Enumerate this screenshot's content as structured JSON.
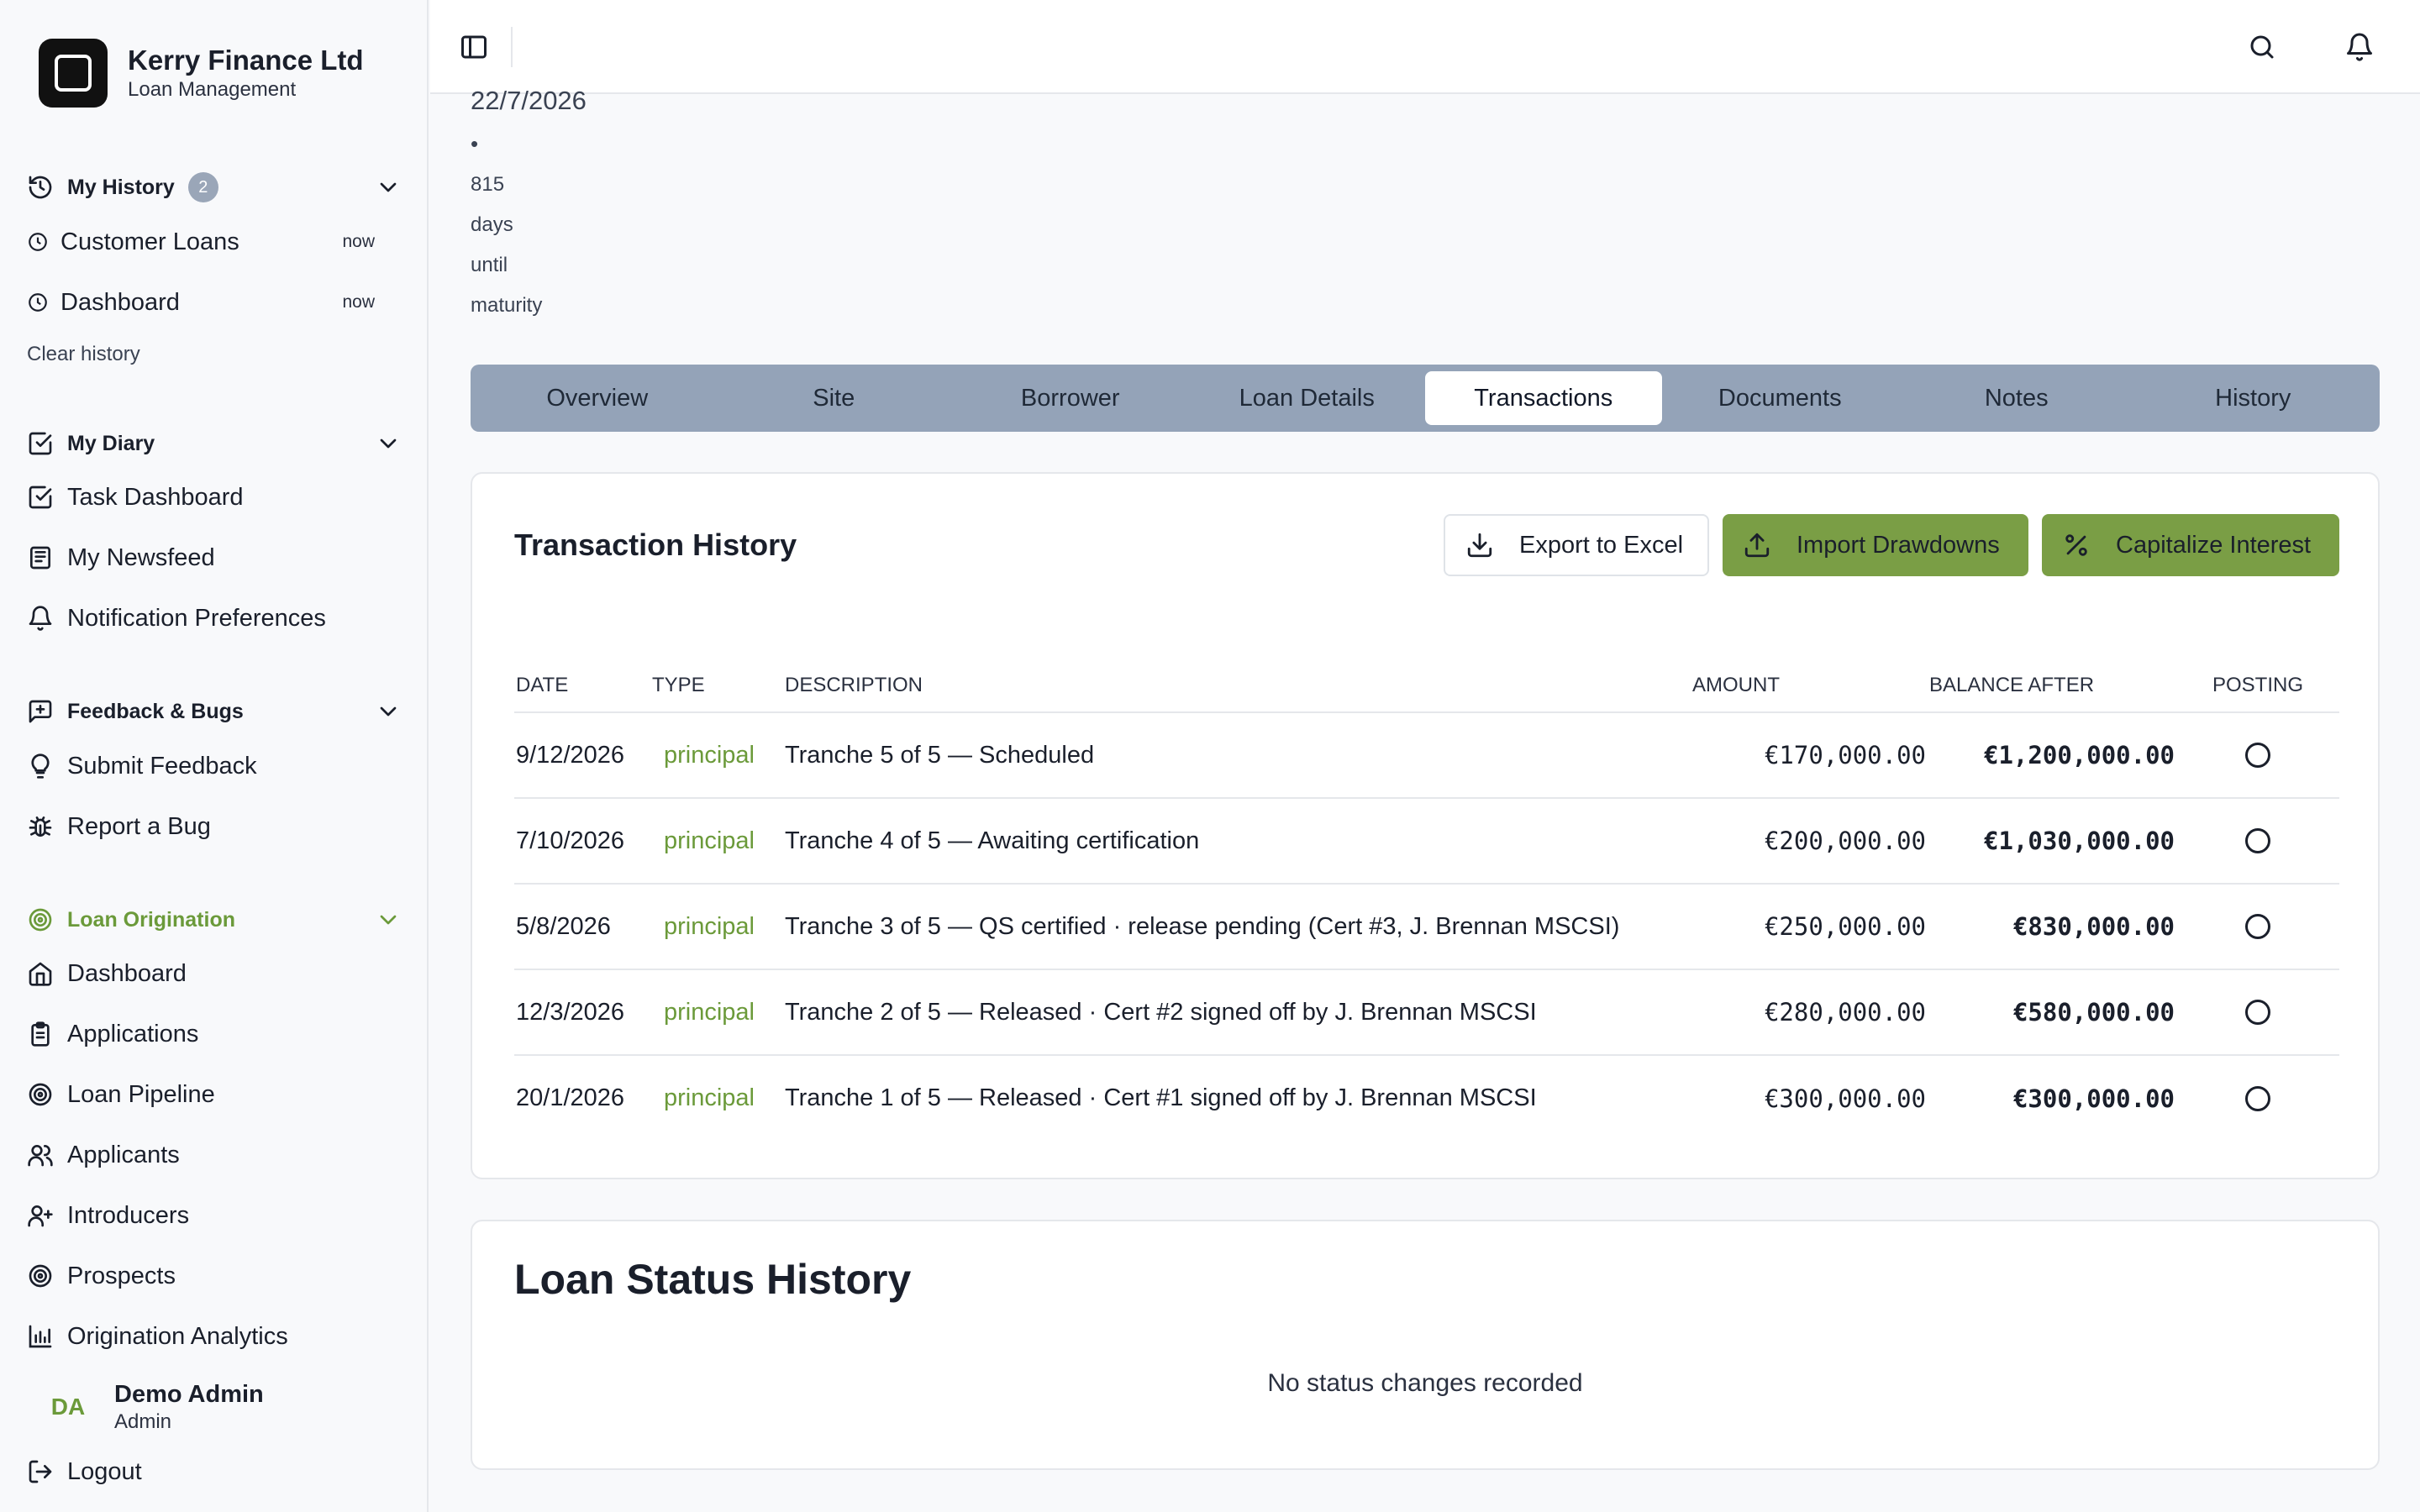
{
  "brand": {
    "name": "Kerry Finance Ltd",
    "subtitle": "Loan Management"
  },
  "sidebar": {
    "history": {
      "label": "My History",
      "count": "2",
      "items": [
        {
          "label": "Customer Loans",
          "time": "now"
        },
        {
          "label": "Dashboard",
          "time": "now"
        }
      ],
      "clear_label": "Clear history"
    },
    "diary": {
      "label": "My Diary",
      "items": [
        {
          "label": "Task Dashboard",
          "icon": "square-check-icon"
        },
        {
          "label": "My Newsfeed",
          "icon": "newspaper-icon"
        },
        {
          "label": "Notification Preferences",
          "icon": "bell-icon"
        }
      ]
    },
    "feedback": {
      "label": "Feedback & Bugs",
      "items": [
        {
          "label": "Submit Feedback",
          "icon": "lightbulb-icon"
        },
        {
          "label": "Report a Bug",
          "icon": "bug-icon"
        }
      ]
    },
    "origination": {
      "label": "Loan Origination",
      "items": [
        {
          "label": "Dashboard",
          "icon": "home-icon"
        },
        {
          "label": "Applications",
          "icon": "clipboard-icon"
        },
        {
          "label": "Loan Pipeline",
          "icon": "target-icon"
        },
        {
          "label": "Applicants",
          "icon": "users-icon"
        },
        {
          "label": "Introducers",
          "icon": "user-plus-icon"
        },
        {
          "label": "Prospects",
          "icon": "target-icon"
        },
        {
          "label": "Origination Analytics",
          "icon": "bar-chart-icon"
        }
      ]
    },
    "user": {
      "initials": "DA",
      "name": "Demo Admin",
      "role": "Admin"
    },
    "logout_label": "Logout"
  },
  "loan_info": {
    "maturity_date": "22/7/2026",
    "separator": "•",
    "days_count": "815",
    "days_word": "days",
    "until_word": "until",
    "maturity_word": "maturity"
  },
  "tabs": [
    {
      "label": "Overview"
    },
    {
      "label": "Site"
    },
    {
      "label": "Borrower"
    },
    {
      "label": "Loan Details"
    },
    {
      "label": "Transactions"
    },
    {
      "label": "Documents"
    },
    {
      "label": "Notes"
    },
    {
      "label": "History"
    }
  ],
  "active_tab": "Transactions",
  "transactions": {
    "title": "Transaction History",
    "buttons": {
      "export": "Export to Excel",
      "import": "Import Drawdowns",
      "capitalize": "Capitalize Interest"
    },
    "columns": {
      "date": "DATE",
      "type": "TYPE",
      "description": "DESCRIPTION",
      "amount": "AMOUNT",
      "balance": "BALANCE AFTER",
      "posting": "POSTING"
    },
    "rows": [
      {
        "date": "9/12/2026",
        "type": "principal",
        "description": "Tranche 5 of 5 — Scheduled",
        "amount": "€170,000.00",
        "balance": "€1,200,000.00"
      },
      {
        "date": "7/10/2026",
        "type": "principal",
        "description": "Tranche 4 of 5 — Awaiting certification",
        "amount": "€200,000.00",
        "balance": "€1,030,000.00"
      },
      {
        "date": "5/8/2026",
        "type": "principal",
        "description": "Tranche 3 of 5 — QS certified · release pending (Cert #3, J. Brennan MSCSI)",
        "amount": "€250,000.00",
        "balance": "€830,000.00"
      },
      {
        "date": "12/3/2026",
        "type": "principal",
        "description": "Tranche 2 of 5 — Released · Cert #2 signed off by J. Brennan MSCSI",
        "amount": "€280,000.00",
        "balance": "€580,000.00"
      },
      {
        "date": "20/1/2026",
        "type": "principal",
        "description": "Tranche 1 of 5 — Released · Cert #1 signed off by J. Brennan MSCSI",
        "amount": "€300,000.00",
        "balance": "€300,000.00"
      }
    ]
  },
  "status_history": {
    "title": "Loan Status History",
    "empty_text": "No status changes recorded"
  },
  "colors": {
    "accent_green": "#7a9e45",
    "tab_bar": "#94a3b8"
  }
}
